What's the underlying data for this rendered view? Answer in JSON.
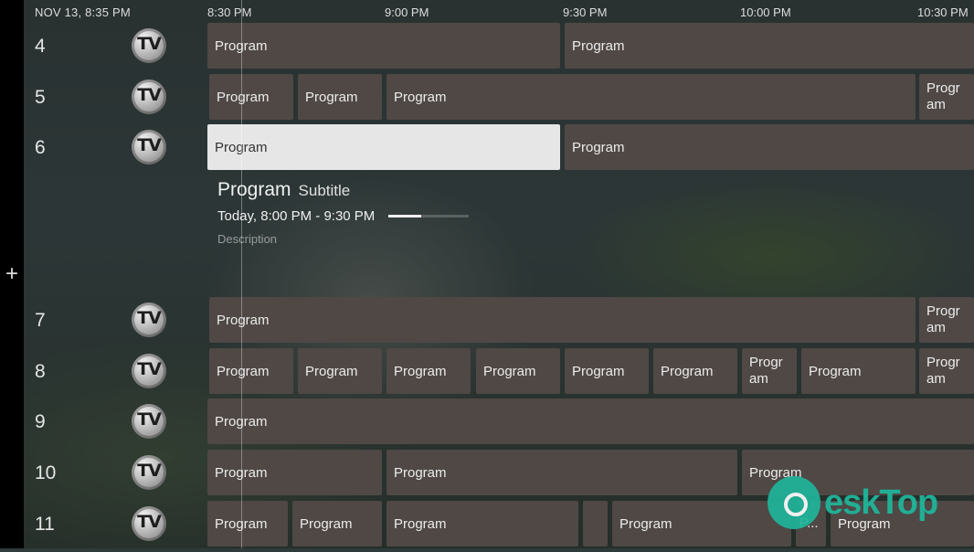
{
  "header": {
    "datetime": "NOV 13, 8:35 PM",
    "times": [
      "8:30 PM",
      "9:00 PM",
      "9:30 PM",
      "10:00 PM",
      "10:30 PM"
    ]
  },
  "sidebar": {
    "add_icon": "plus-icon"
  },
  "channels": [
    {
      "number": "4",
      "logo": "TV",
      "programs": [
        "Program",
        "Program"
      ]
    },
    {
      "number": "5",
      "logo": "TV",
      "programs": [
        "Program",
        "Program",
        "Program",
        "Program"
      ]
    },
    {
      "number": "6",
      "logo": "TV",
      "programs": [
        "Program",
        "Program"
      ]
    },
    {
      "number": "7",
      "logo": "TV",
      "programs": [
        "Program",
        "Program"
      ]
    },
    {
      "number": "8",
      "logo": "TV",
      "programs": [
        "Program",
        "Program",
        "Program",
        "Program",
        "Program",
        "Program",
        "Program",
        "Program",
        "Program"
      ]
    },
    {
      "number": "9",
      "logo": "TV",
      "programs": [
        "Program"
      ]
    },
    {
      "number": "10",
      "logo": "TV",
      "programs": [
        "Program",
        "Program",
        "Program"
      ]
    },
    {
      "number": "11",
      "logo": "TV",
      "programs": [
        "Program",
        "Program",
        "Program",
        "",
        "Program",
        "P...",
        "Program"
      ]
    }
  ],
  "selected_program": {
    "title": "Program",
    "subtitle": "Subtitle",
    "time": "Today, 8:00 PM - 9:30 PM",
    "progress": 0.41,
    "description": "Description"
  },
  "watermark": {
    "text": "eskTop",
    "icon": "desktop-logo-icon"
  }
}
